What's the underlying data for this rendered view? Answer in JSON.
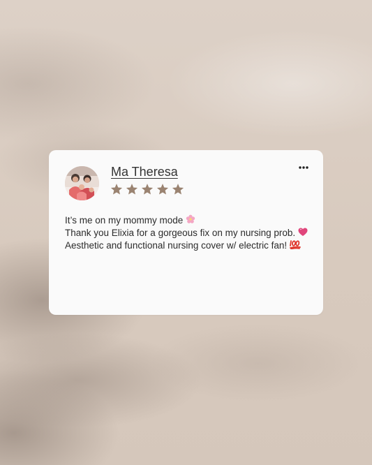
{
  "review": {
    "author_name": "Ma Theresa",
    "rating": 5,
    "rating_max": 5,
    "avatar_icon": "family-photo-avatar",
    "star_color": "#9a8371",
    "menu_icon": "more-options-icon",
    "lines": [
      {
        "text": "It’s me on my mommy mode",
        "emoji": "cherry-blossom-icon"
      },
      {
        "text": "Thank you Elixia for a gorgeous fix on my nursing prob.",
        "emoji": "pink-heart-icon"
      },
      {
        "text": "Aesthetic and functional nursing cover w/ electric fan!",
        "emoji": "hundred-points-icon"
      }
    ]
  },
  "colors": {
    "background": "#dccfc4",
    "card": "#fafafa",
    "text": "#2b2b2b"
  }
}
